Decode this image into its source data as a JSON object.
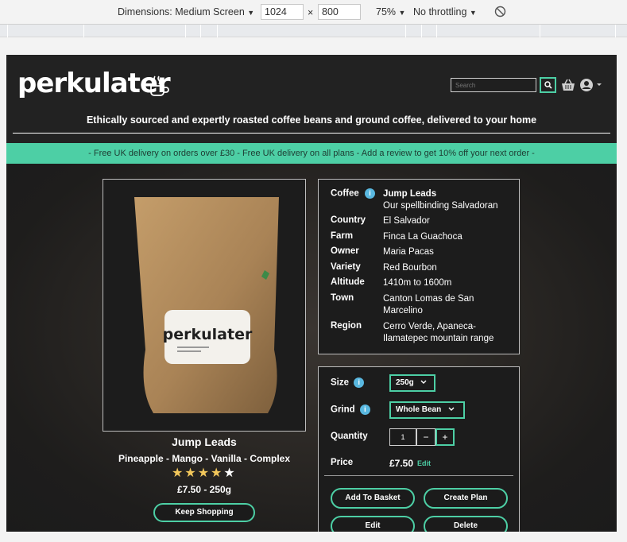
{
  "devtools": {
    "dimensions_label": "Dimensions: Medium Screen",
    "width": "1024",
    "times": "×",
    "height": "800",
    "zoom": "75%",
    "throttling": "No throttling",
    "dropdown_icon": "▼",
    "rotate_icon": "rotate-icon"
  },
  "site": {
    "logo": "perkulater",
    "search_placeholder": "Search",
    "tagline": "Ethically sourced and expertly roasted coffee beans and ground coffee, delivered to your home",
    "banner": "- Free UK delivery on orders over £30 - Free UK delivery on all plans - Add a review to get 10% off your next order -",
    "accent_color": "#4dcfa5",
    "info_color": "#59b8e0"
  },
  "product": {
    "bag_label": "perkulater",
    "name": "Jump Leads",
    "flavors": "Pineapple - Mango - Vanilla - Complex",
    "rating": 4,
    "rating_max": 5,
    "price_size": "£7.50 - 250g",
    "keep_shopping": "Keep Shopping"
  },
  "details": {
    "coffee_label": "Coffee",
    "coffee_value": "Jump Leads",
    "coffee_sub": "Our spellbinding Salvadoran",
    "rows": [
      {
        "key": "Country",
        "value": "El Salvador"
      },
      {
        "key": "Farm",
        "value": "Finca La Guachoca"
      },
      {
        "key": "Owner",
        "value": "Maria Pacas"
      },
      {
        "key": "Variety",
        "value": "Red Bourbon"
      },
      {
        "key": "Altitude",
        "value": "1410m to 1600m"
      },
      {
        "key": "Town",
        "value": "Canton Lomas de San Marcelino"
      },
      {
        "key": "Region",
        "value": "Cerro Verde, Apaneca-Ilamatepec mountain range"
      }
    ]
  },
  "options": {
    "size_label": "Size",
    "size_value": "250g",
    "grind_label": "Grind",
    "grind_value": "Whole Bean",
    "quantity_label": "Quantity",
    "quantity_value": "1",
    "minus": "−",
    "plus": "+",
    "price_label": "Price",
    "price_value": "£7.50",
    "edit_link": "Edit",
    "add_to_basket": "Add To Basket",
    "create_plan": "Create Plan",
    "edit_button": "Edit",
    "delete_button": "Delete"
  }
}
